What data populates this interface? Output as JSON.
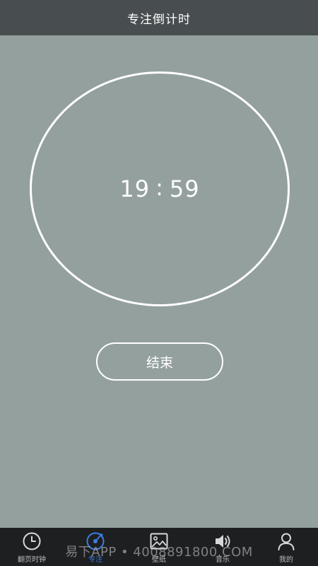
{
  "header": {
    "title": "专注倒计时"
  },
  "timer": {
    "minutes": "19",
    "separator": ":",
    "seconds": "59"
  },
  "actions": {
    "end_label": "结束"
  },
  "tabbar": {
    "active_color": "#3d7be0",
    "items": [
      {
        "label": "翻页时钟",
        "icon": "clock-icon"
      },
      {
        "label": "专注",
        "icon": "focus-icon"
      },
      {
        "label": "壁纸",
        "icon": "image-icon"
      },
      {
        "label": "音乐",
        "icon": "speaker-icon"
      },
      {
        "label": "我的",
        "icon": "person-icon"
      }
    ]
  },
  "watermark": {
    "text": "易下APP • 4008891800.COM"
  },
  "colors": {
    "background": "#94a09e",
    "header": "#484d50",
    "tabbar": "#1d1f20"
  }
}
